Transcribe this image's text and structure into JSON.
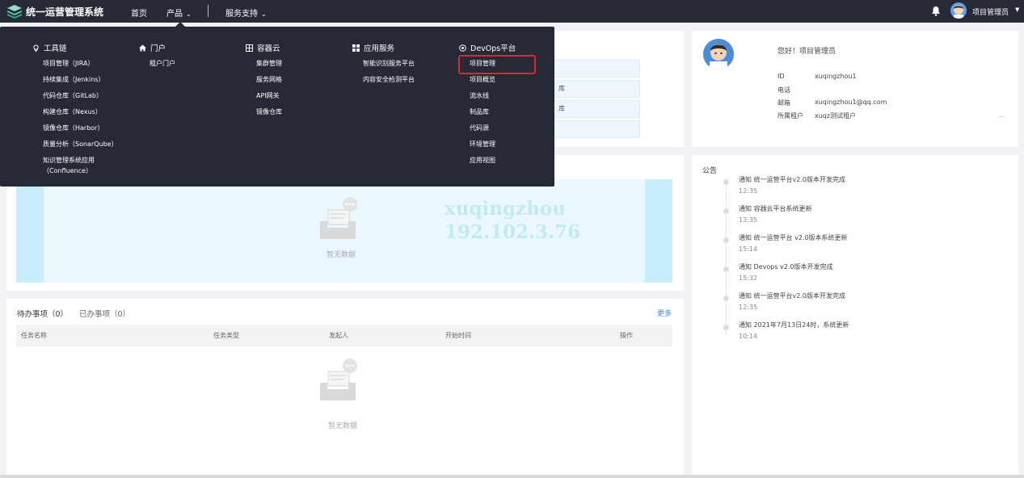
{
  "app": {
    "title": "统一运营管理系统",
    "nav": {
      "home": "首页",
      "products": "产品",
      "services": "服务支持"
    },
    "user": "项目管理员"
  },
  "dropdown": {
    "columns": [
      {
        "icon": "location-pin-icon",
        "title": "工具链",
        "items": [
          "项目管理（JIRA）",
          "持续集成（Jenkins）",
          "代码仓库（GitLab）",
          "构建仓库（Nexus）",
          "镜像仓库（Harbor）",
          "质量分析（SonarQube）",
          "知识管理系统应用",
          "（Confluence）"
        ]
      },
      {
        "icon": "home-icon",
        "title": "门户",
        "items": [
          "租户门户"
        ]
      },
      {
        "icon": "grid-icon",
        "title": "容器云",
        "items": [
          "集群管理",
          "服务网格",
          "API网关",
          "镜像仓库"
        ]
      },
      {
        "icon": "apps-icon",
        "title": "应用服务",
        "items": [
          "智能识别服务平台",
          "内容安全检测平台"
        ]
      },
      {
        "icon": "target-icon",
        "title": "DevOps平台",
        "items": [
          "项目管理",
          "项目概览",
          "流水线",
          "制品库",
          "代码源",
          "环境管理",
          "应用视图"
        ]
      }
    ]
  },
  "quick_links": [
    "",
    "库",
    "库",
    ""
  ],
  "profile": {
    "greeting": "您好！项目管理员",
    "fields": [
      {
        "label": "ID",
        "value": "xuqingzhou1"
      },
      {
        "label": "电话",
        "value": ""
      },
      {
        "label": "邮箱",
        "value": "xuqingzhou1@qq.com"
      },
      {
        "label": "所属租户",
        "value": "xuqz测试租户"
      }
    ],
    "more": "..."
  },
  "watermark": {
    "line1": "xuqingzhou",
    "line2": "192.102.3.76"
  },
  "chart": {
    "empty_text": "暂无数据"
  },
  "todo": {
    "tab_pending": "待办事项（0）",
    "tab_done": "已办事项（0）",
    "more": "更多",
    "columns": [
      "任务名称",
      "任务类型",
      "发起人",
      "开始时间",
      "操作"
    ],
    "empty_text": "暂无数据"
  },
  "notices": {
    "title": "公告",
    "items": [
      {
        "text": "通知 统一运营平台v2.0版本开发完成",
        "time": "12:35"
      },
      {
        "text": "通知 容器云平台系统更新",
        "time": "13:35"
      },
      {
        "text": "通知 统一运营平台 v2.0版本系统更新",
        "time": "15:14"
      },
      {
        "text": "通知 Devops v2.0版本开发完成",
        "time": "15:32"
      },
      {
        "text": "通知 统一运营平台v2.0版本开发完成",
        "time": "12:35"
      },
      {
        "text": "通知 2021年7月13日24时，系统更新",
        "time": "10:14"
      }
    ]
  },
  "colors": {
    "topbar": "#262a36",
    "highlight": "#e5232a",
    "link": "#3d8af7"
  }
}
